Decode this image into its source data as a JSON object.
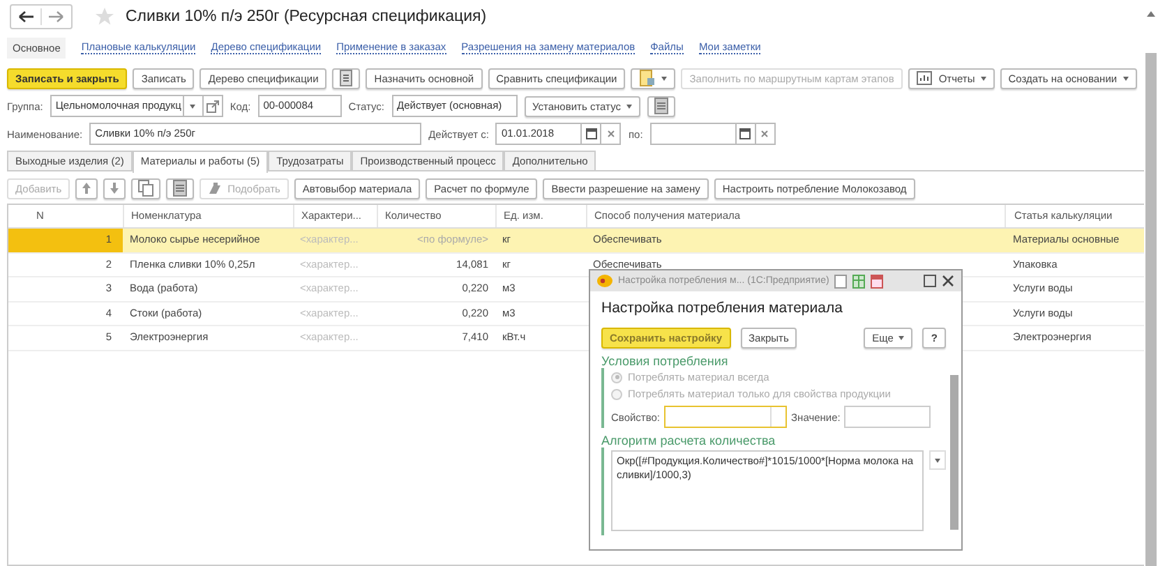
{
  "title": "Сливки 10% п/э 250г (Ресурсная спецификация)",
  "links": [
    {
      "label": "Основное",
      "selected": true
    },
    {
      "label": "Плановые калькуляции",
      "selected": false
    },
    {
      "label": "Дерево спецификации",
      "selected": false
    },
    {
      "label": "Применение в заказах",
      "selected": false
    },
    {
      "label": "Разрешения на замену материалов",
      "selected": false
    },
    {
      "label": "Файлы",
      "selected": false
    },
    {
      "label": "Мои заметки",
      "selected": false
    }
  ],
  "toolbar": [
    {
      "kind": "primary",
      "label": "Записать и закрыть"
    },
    {
      "kind": "button",
      "label": "Записать"
    },
    {
      "kind": "button",
      "label": "Дерево спецификации"
    },
    {
      "kind": "icon"
    },
    {
      "kind": "button",
      "label": "Назначить основной"
    },
    {
      "kind": "button",
      "label": "Сравнить спецификации"
    },
    {
      "kind": "icon-menu"
    },
    {
      "kind": "disabled",
      "label": "Заполнить по маршрутным картам этапов"
    },
    {
      "kind": "icon-menu",
      "label": "Отчеты"
    },
    {
      "kind": "menu",
      "label": "Создать на основании"
    }
  ],
  "form": {
    "group": {
      "label": "Группа:",
      "value": "Цельномолочная продукц"
    },
    "code": {
      "label": "Код:",
      "value": "00-000084"
    },
    "status": {
      "label": "Статус:",
      "value": "Действует (основная)"
    },
    "status_button": "Установить статус",
    "name": {
      "label": "Наименование:",
      "value": "Сливки 10% п/э 250г"
    },
    "valid_from": {
      "label": "Действует с:",
      "value": "01.01.2018"
    },
    "valid_to": {
      "label": "по:"
    }
  },
  "tabs": [
    {
      "label": "Выходные изделия (2)",
      "selected": false
    },
    {
      "label": "Материалы и работы (5)",
      "selected": true
    },
    {
      "label": "Трудозатраты",
      "selected": false
    },
    {
      "label": "Производственный процесс",
      "selected": false
    },
    {
      "label": "Дополнительно",
      "selected": false
    }
  ],
  "table_toolbar": [
    {
      "kind": "disabled",
      "label": "Добавить"
    },
    {
      "kind": "icon"
    },
    {
      "kind": "icon"
    },
    {
      "kind": "icon"
    },
    {
      "kind": "icon"
    },
    {
      "kind": "disabled",
      "label": "Подобрать"
    },
    {
      "kind": "button",
      "label": "Автовыбор материала"
    },
    {
      "kind": "button",
      "label": "Расчет по формуле"
    },
    {
      "kind": "button",
      "label": "Ввести разрешение на замену"
    },
    {
      "kind": "button",
      "label": "Настроить потребление Молокозавод"
    }
  ],
  "table": {
    "columns": [
      "N",
      "Номенклатура",
      "Характери...",
      "Количество",
      "Ед. изм.",
      "Способ получения материала",
      "Статья калькуляции"
    ],
    "rows": [
      {
        "selected": true,
        "cells": [
          "1",
          "Молоко сырье несерийное",
          "<характер...",
          "<по формуле>",
          "кг",
          "Обеспечивать",
          "Материалы основные"
        ]
      },
      {
        "selected": false,
        "cells": [
          "2",
          "Пленка сливки 10% 0,25л",
          "<характер...",
          "14,081",
          "кг",
          "Обеспечивать",
          "Упаковка"
        ]
      },
      {
        "selected": false,
        "cells": [
          "3",
          "Вода (работа)",
          "<характер...",
          "0,220",
          "м3",
          "",
          "Услуги воды"
        ]
      },
      {
        "selected": false,
        "cells": [
          "4",
          "Стоки (работа)",
          "<характер...",
          "0,220",
          "м3",
          "",
          "Услуги воды"
        ]
      },
      {
        "selected": false,
        "cells": [
          "5",
          "Электроэнергия",
          "<характер...",
          "7,410",
          "кВт.ч",
          "",
          "Электроэнергия"
        ]
      }
    ]
  },
  "dialog": {
    "window_title": "Настройка потребления м... (1С:Предприятие)",
    "heading": "Настройка потребления материала",
    "save_button": "Сохранить настройку",
    "close_button": "Закрыть",
    "more_button": "Еще",
    "help_button": "?",
    "conditions": {
      "title": "Условия потребления",
      "options": [
        {
          "label": "Потреблять материал всегда",
          "selected": true,
          "disabled": true
        },
        {
          "label": "Потреблять материал только для свойства продукции",
          "selected": false,
          "disabled": true
        }
      ],
      "property_label": "Свойство:",
      "value_label": "Значение:"
    },
    "algorithm": {
      "title": "Алгоритм расчета количества",
      "formula": "Окр([#Продукция.Количество#]*1015/1000*[Норма молока на сливки]/1000,3)"
    }
  }
}
